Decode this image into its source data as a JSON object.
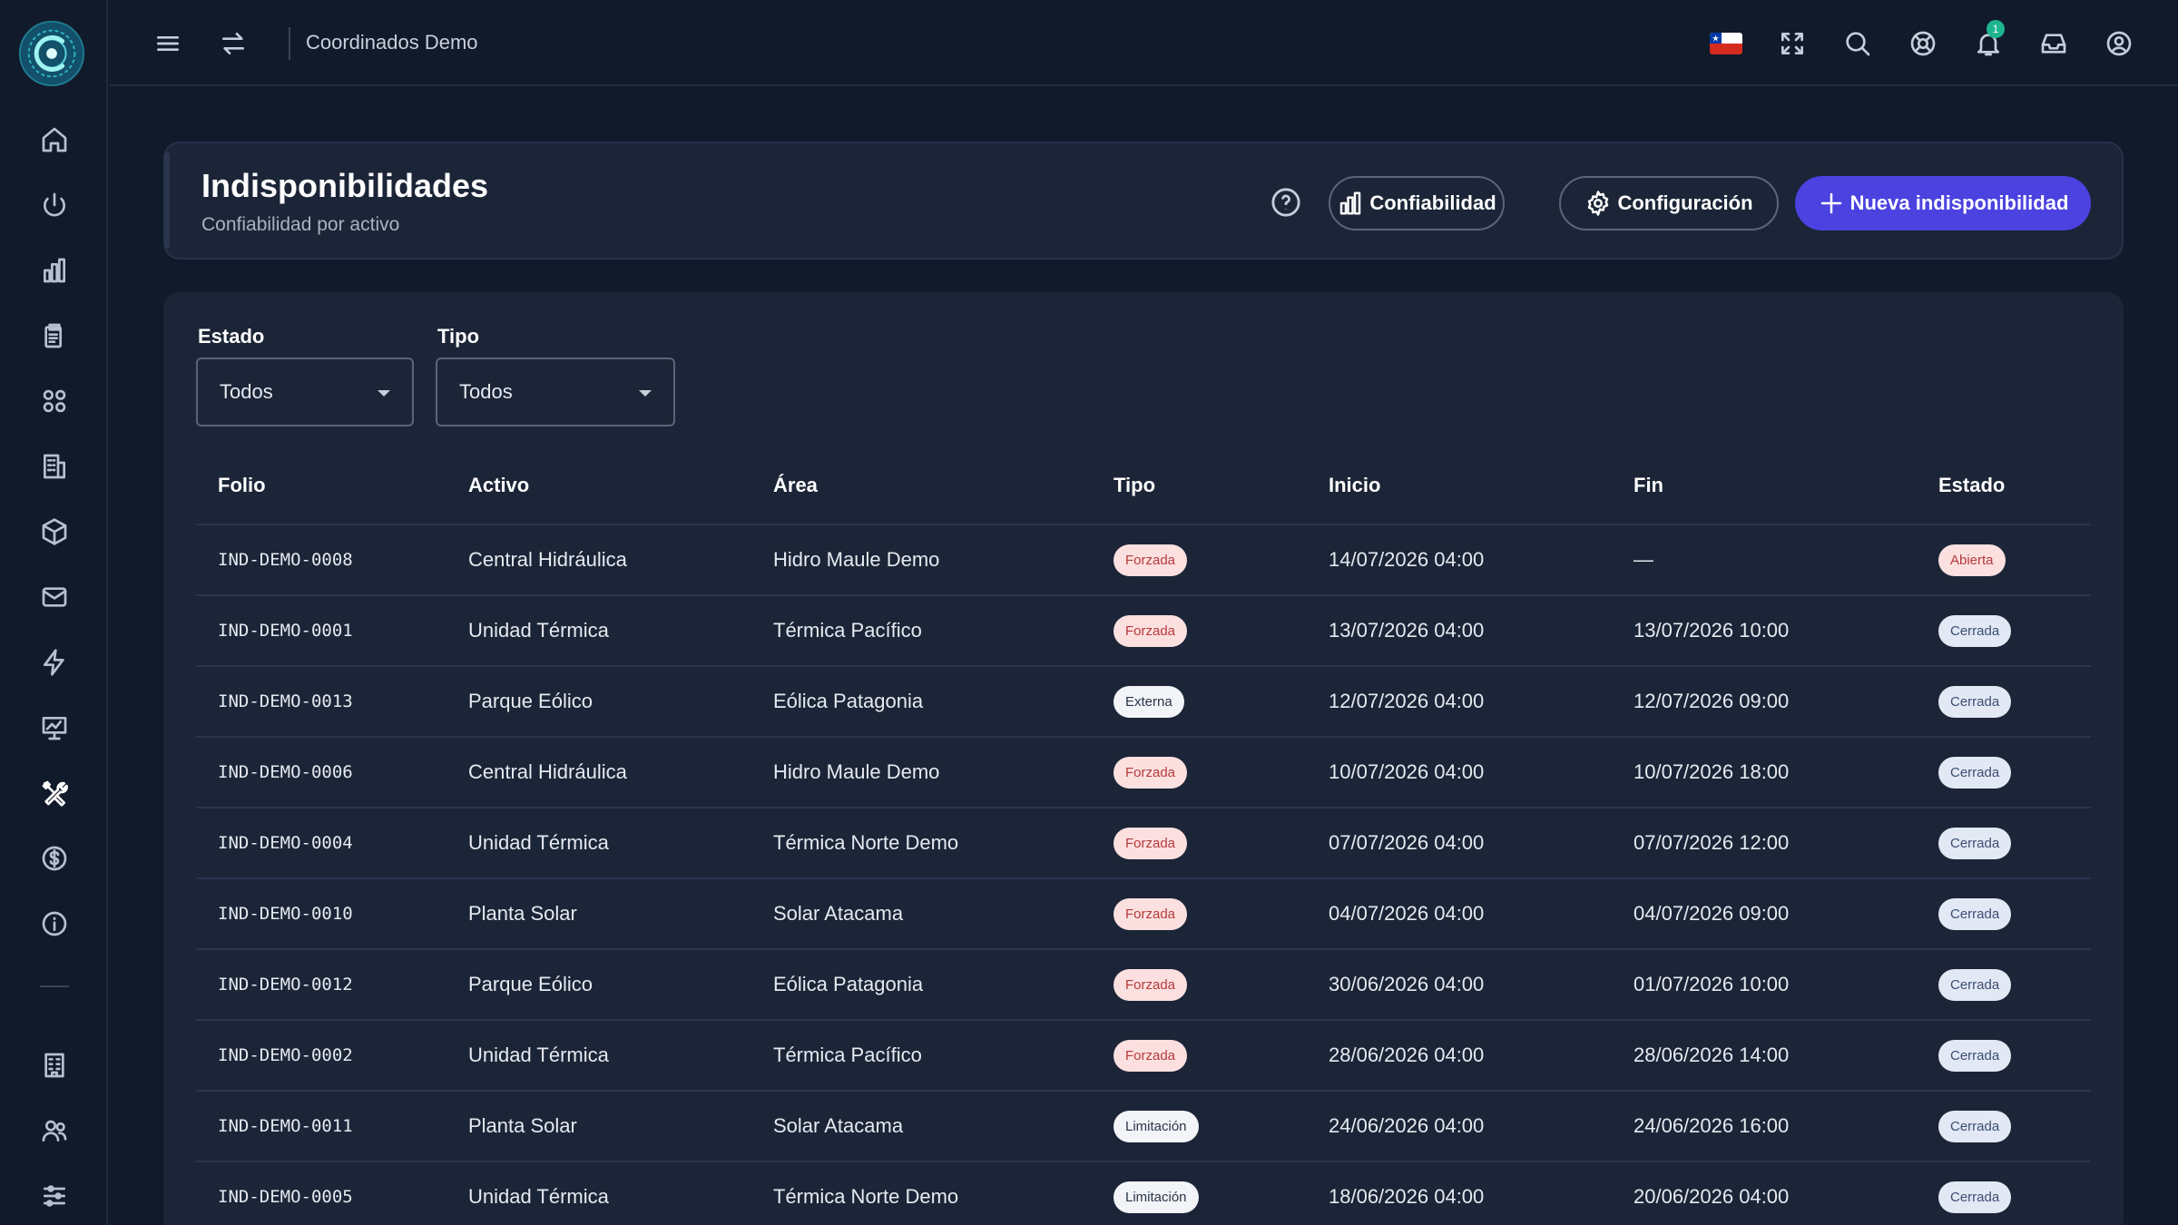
{
  "topbar": {
    "title": "Coordinados Demo",
    "notification_count": "1"
  },
  "header": {
    "title": "Indisponibilidades",
    "subtitle": "Confiabilidad por activo",
    "btn_confiabilidad": "Confiabilidad",
    "btn_configuracion": "Configuración",
    "btn_nueva": "Nueva indisponibilidad"
  },
  "filters": {
    "estado_label": "Estado",
    "estado_value": "Todos",
    "tipo_label": "Tipo",
    "tipo_value": "Todos"
  },
  "table": {
    "columns": [
      "Folio",
      "Activo",
      "Área",
      "Tipo",
      "Inicio",
      "Fin",
      "Estado"
    ],
    "rows": [
      {
        "folio": "IND-DEMO-0008",
        "activo": "Central Hidráulica",
        "area": "Hidro Maule Demo",
        "tipo": "Forzada",
        "inicio": "14/07/2026 04:00",
        "fin": "—",
        "estado": "Abierta"
      },
      {
        "folio": "IND-DEMO-0001",
        "activo": "Unidad Térmica",
        "area": "Térmica Pacífico",
        "tipo": "Forzada",
        "inicio": "13/07/2026 04:00",
        "fin": "13/07/2026 10:00",
        "estado": "Cerrada"
      },
      {
        "folio": "IND-DEMO-0013",
        "activo": "Parque Eólico",
        "area": "Eólica Patagonia",
        "tipo": "Externa",
        "inicio": "12/07/2026 04:00",
        "fin": "12/07/2026 09:00",
        "estado": "Cerrada"
      },
      {
        "folio": "IND-DEMO-0006",
        "activo": "Central Hidráulica",
        "area": "Hidro Maule Demo",
        "tipo": "Forzada",
        "inicio": "10/07/2026 04:00",
        "fin": "10/07/2026 18:00",
        "estado": "Cerrada"
      },
      {
        "folio": "IND-DEMO-0004",
        "activo": "Unidad Térmica",
        "area": "Térmica Norte Demo",
        "tipo": "Forzada",
        "inicio": "07/07/2026 04:00",
        "fin": "07/07/2026 12:00",
        "estado": "Cerrada"
      },
      {
        "folio": "IND-DEMO-0010",
        "activo": "Planta Solar",
        "area": "Solar Atacama",
        "tipo": "Forzada",
        "inicio": "04/07/2026 04:00",
        "fin": "04/07/2026 09:00",
        "estado": "Cerrada"
      },
      {
        "folio": "IND-DEMO-0012",
        "activo": "Parque Eólico",
        "area": "Eólica Patagonia",
        "tipo": "Forzada",
        "inicio": "30/06/2026 04:00",
        "fin": "01/07/2026 10:00",
        "estado": "Cerrada"
      },
      {
        "folio": "IND-DEMO-0002",
        "activo": "Unidad Térmica",
        "area": "Térmica Pacífico",
        "tipo": "Forzada",
        "inicio": "28/06/2026 04:00",
        "fin": "28/06/2026 14:00",
        "estado": "Cerrada"
      },
      {
        "folio": "IND-DEMO-0011",
        "activo": "Planta Solar",
        "area": "Solar Atacama",
        "tipo": "Limitación",
        "inicio": "24/06/2026 04:00",
        "fin": "24/06/2026 16:00",
        "estado": "Cerrada"
      },
      {
        "folio": "IND-DEMO-0005",
        "activo": "Unidad Térmica",
        "area": "Térmica Norte Demo",
        "tipo": "Limitación",
        "inicio": "18/06/2026 04:00",
        "fin": "20/06/2026 04:00",
        "estado": "Cerrada"
      }
    ]
  },
  "icons": {
    "sidebar": [
      "home-icon",
      "power-icon",
      "bar-chart-icon",
      "clipboard-icon",
      "grid-icon",
      "building-icon",
      "box-icon",
      "mail-icon",
      "bolt-icon",
      "presentation-icon",
      "tools-icon",
      "dollar-icon",
      "info-icon",
      "office-icon",
      "users-icon",
      "sliders-icon"
    ],
    "topbar": [
      "menu-icon",
      "swap-icon",
      "chile-flag-icon",
      "fullscreen-icon",
      "search-icon",
      "lifebuoy-icon",
      "bell-icon",
      "inbox-icon",
      "user-icon"
    ]
  },
  "colors": {
    "background": "#111a2b",
    "card": "#1b2537",
    "primary": "#4b42e0",
    "chip_forzada_bg": "#fce0e0",
    "chip_forzada_text": "#b53a3a",
    "chip_cerrada_bg": "#e2e8f4",
    "badge": "#1fb58f"
  }
}
